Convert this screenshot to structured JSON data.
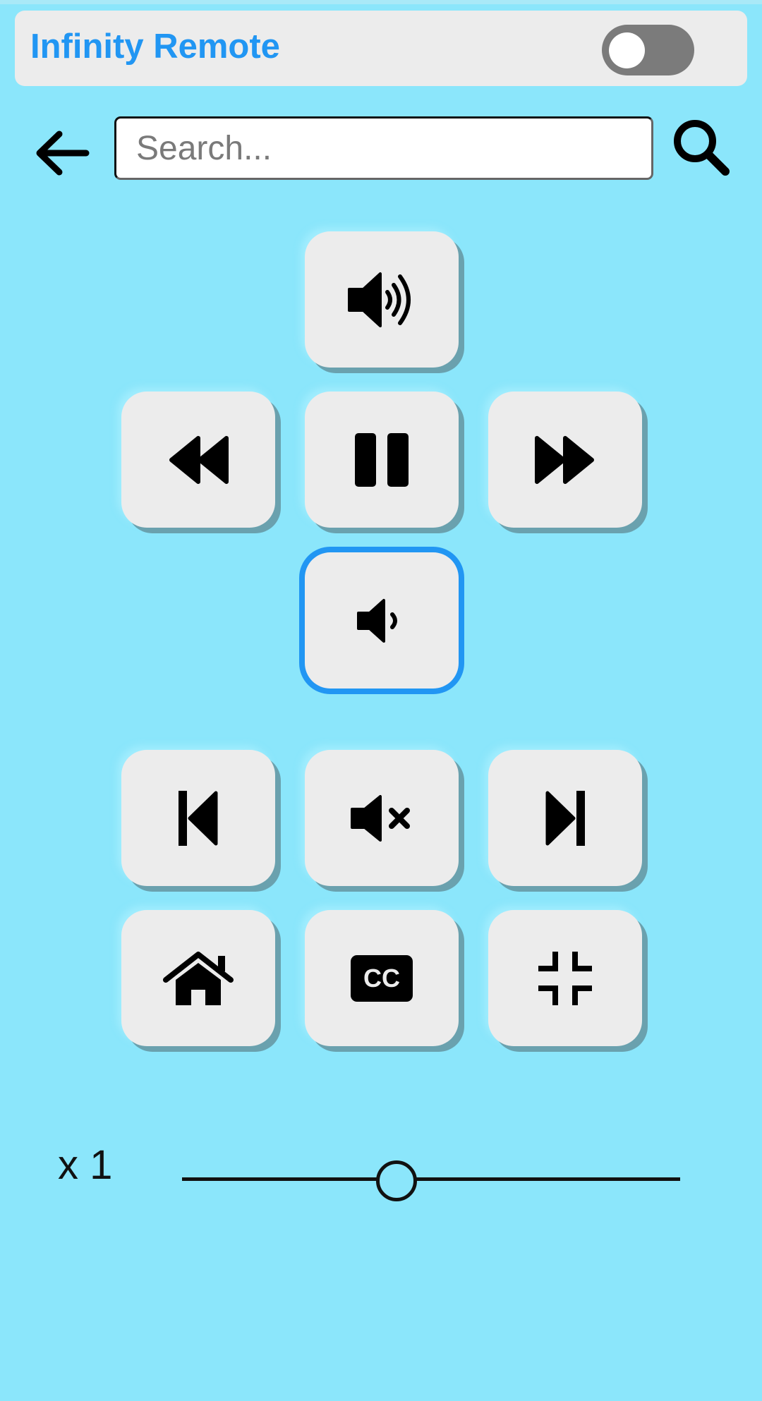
{
  "app": {
    "title": "Infinity Remote",
    "accent_color": "#2196f3",
    "background_color": "#8be6fb"
  },
  "header": {
    "toggle_on": false
  },
  "search": {
    "placeholder": "Search...",
    "value": ""
  },
  "remote": {
    "buttons": [
      {
        "id": "volume-up",
        "icon": "volume-up-icon"
      },
      {
        "id": "rewind",
        "icon": "rewind-icon"
      },
      {
        "id": "pause",
        "icon": "pause-icon"
      },
      {
        "id": "fast-forward",
        "icon": "fast-forward-icon"
      },
      {
        "id": "volume-down",
        "icon": "volume-down-icon",
        "focused": true
      },
      {
        "id": "skip-previous",
        "icon": "skip-previous-icon"
      },
      {
        "id": "mute",
        "icon": "mute-icon"
      },
      {
        "id": "skip-next",
        "icon": "skip-next-icon"
      },
      {
        "id": "home",
        "icon": "home-icon"
      },
      {
        "id": "closed-captions",
        "icon": "closed-captions-icon",
        "text": "CC"
      },
      {
        "id": "exit-fullscreen",
        "icon": "compress-icon"
      }
    ]
  },
  "speed": {
    "label": "x 1",
    "level": 0.43
  }
}
